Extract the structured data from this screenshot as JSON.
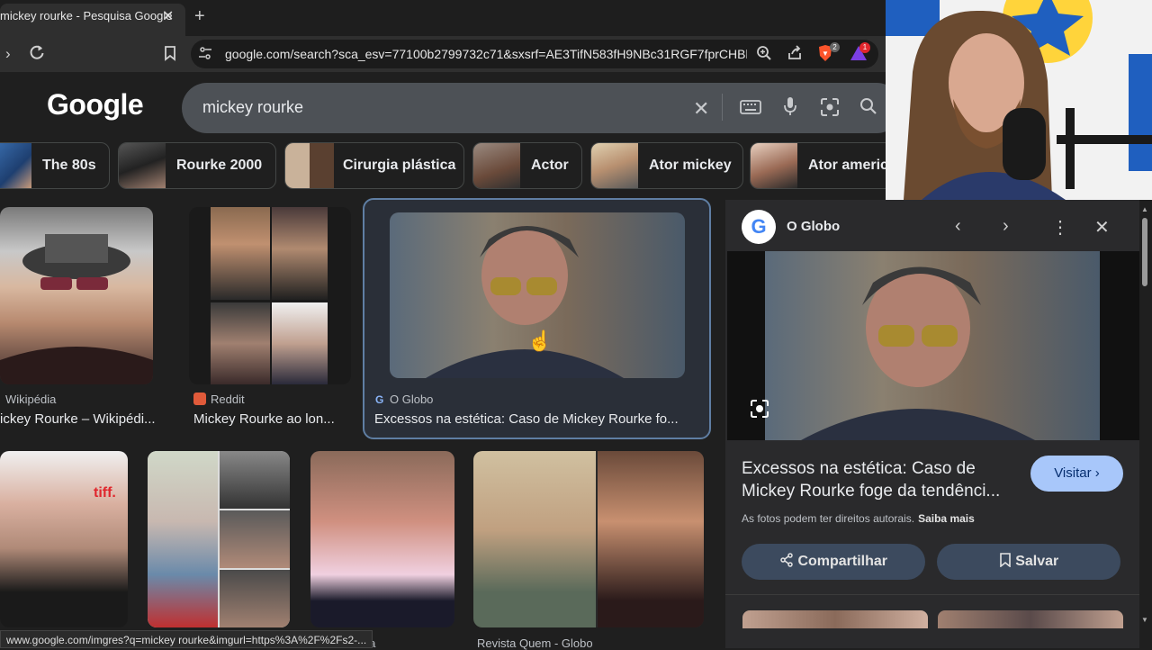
{
  "browser": {
    "tab_title": "mickey rourke - Pesquisa Google",
    "tab_close": "✕",
    "new_tab": "+",
    "url": "google.com/search?sca_esv=77100b2799732c71&sxsrf=AE3TifN583fH9NBc31RGF7fprCHBh...",
    "brave_badge": "2",
    "alert_badge": "1",
    "status_url": "www.google.com/imgres?q=mickey rourke&imgurl=https%3A%2F%2Fs2-..."
  },
  "google": {
    "logo": "Google",
    "query": "mickey rourke"
  },
  "chips": [
    {
      "label": "The 80s"
    },
    {
      "label": "Rourke 2000"
    },
    {
      "label": "Cirurgia plástica"
    },
    {
      "label": "Actor"
    },
    {
      "label": "Ator mickey"
    },
    {
      "label": "Ator americ"
    }
  ],
  "results": [
    {
      "source": "Wikipédia",
      "title": "ickey Rourke – Wikipédi..."
    },
    {
      "source": "Reddit",
      "title": "Mickey Rourke ao lon..."
    },
    {
      "source": "O Globo",
      "title": "Excessos na estética: Caso de Mickey Rourke fo..."
    }
  ],
  "row2_labels": {
    "r2a": "dia",
    "r2b": "Revista Quem - Globo"
  },
  "panel": {
    "logo_letter": "G",
    "source": "O Globo",
    "title": "Excessos na estética: Caso de Mickey Rourke foge da tendênci...",
    "visit_label": "Visitar",
    "copyright": "As fotos podem ter direitos autorais.",
    "learn_more": "Saiba mais",
    "share_label": "Compartilhar",
    "save_label": "Salvar"
  },
  "colors": {
    "background": "#1f1f1f",
    "accent": "#a8c7fa",
    "selected_border": "#5f7ea3"
  }
}
